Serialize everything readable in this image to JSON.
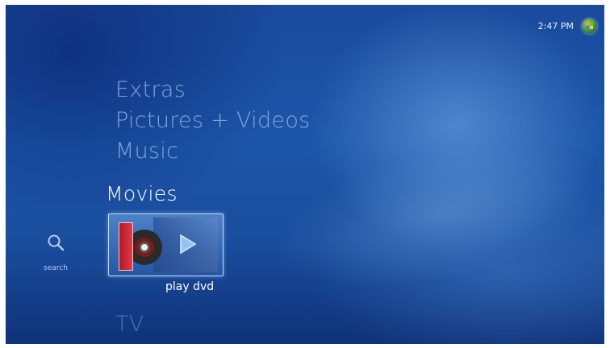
{
  "status_bar": {
    "time": "2:47 PM",
    "start_icon": "windows-orb-icon"
  },
  "menu": {
    "items_above": [
      "Extras",
      "Pictures + Videos",
      "Music"
    ],
    "active": "Movies",
    "items_below": [
      "TV"
    ]
  },
  "side_panel": {
    "search_label": "search",
    "search_icon": "magnifier-icon"
  },
  "active_strip": {
    "tile_label": "play dvd",
    "tile_icon": "play-icon"
  }
}
